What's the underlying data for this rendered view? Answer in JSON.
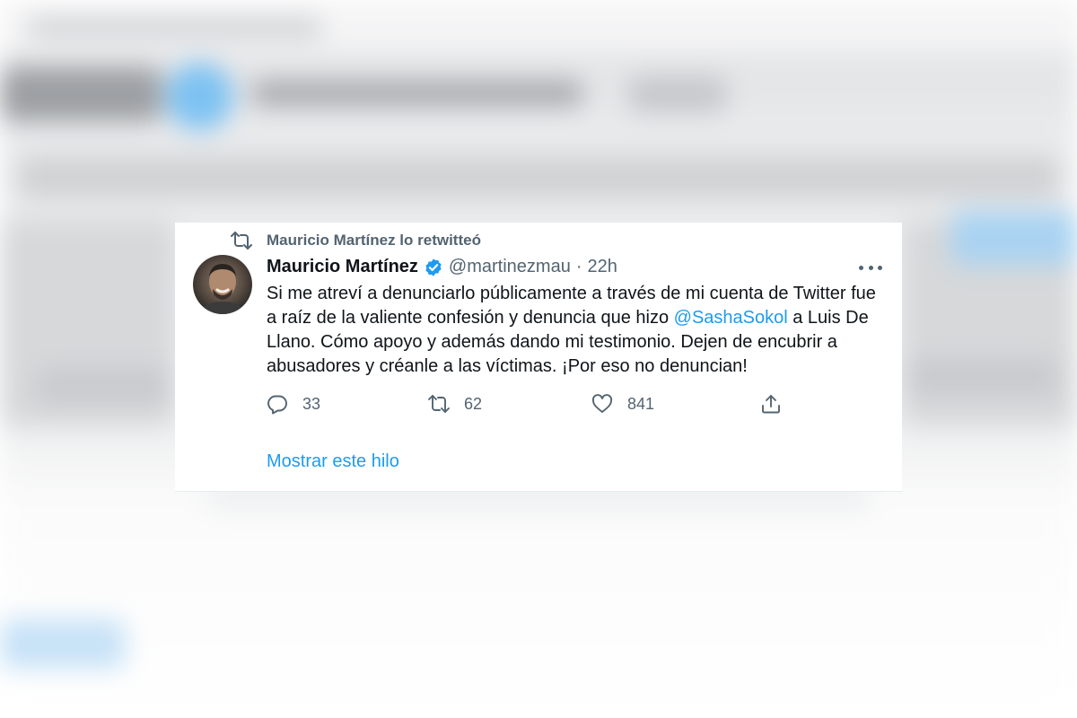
{
  "retweet_banner": "Mauricio Martínez lo retwitteó",
  "tweet": {
    "author_name": "Mauricio Martínez",
    "handle": "@martinezmau",
    "separator": "·",
    "time": "22h",
    "text_before": "Si me atreví a denunciarlo públicamente a través de mi cuenta de Twitter fue a raíz de la valiente confesión y denuncia que hizo ",
    "mention": "@SashaSokol",
    "text_after": " a Luis De Llano. Cómo apoyo y además dando mi testimonio. Dejen de encubrir a abusadores y créanle a las víctimas. ¡Por eso no denuncian!",
    "counts": {
      "replies": "33",
      "retweets": "62",
      "likes": "841"
    }
  },
  "show_thread_label": "Mostrar este hilo",
  "colors": {
    "accent": "#1d9bf0",
    "secondary_text": "#536471",
    "primary_text": "#0f1419"
  },
  "icons": {
    "retweet": "retweet-icon",
    "verified": "verified-badge-icon",
    "more": "more-options-icon",
    "reply": "reply-icon",
    "like": "heart-icon",
    "share": "share-icon"
  }
}
